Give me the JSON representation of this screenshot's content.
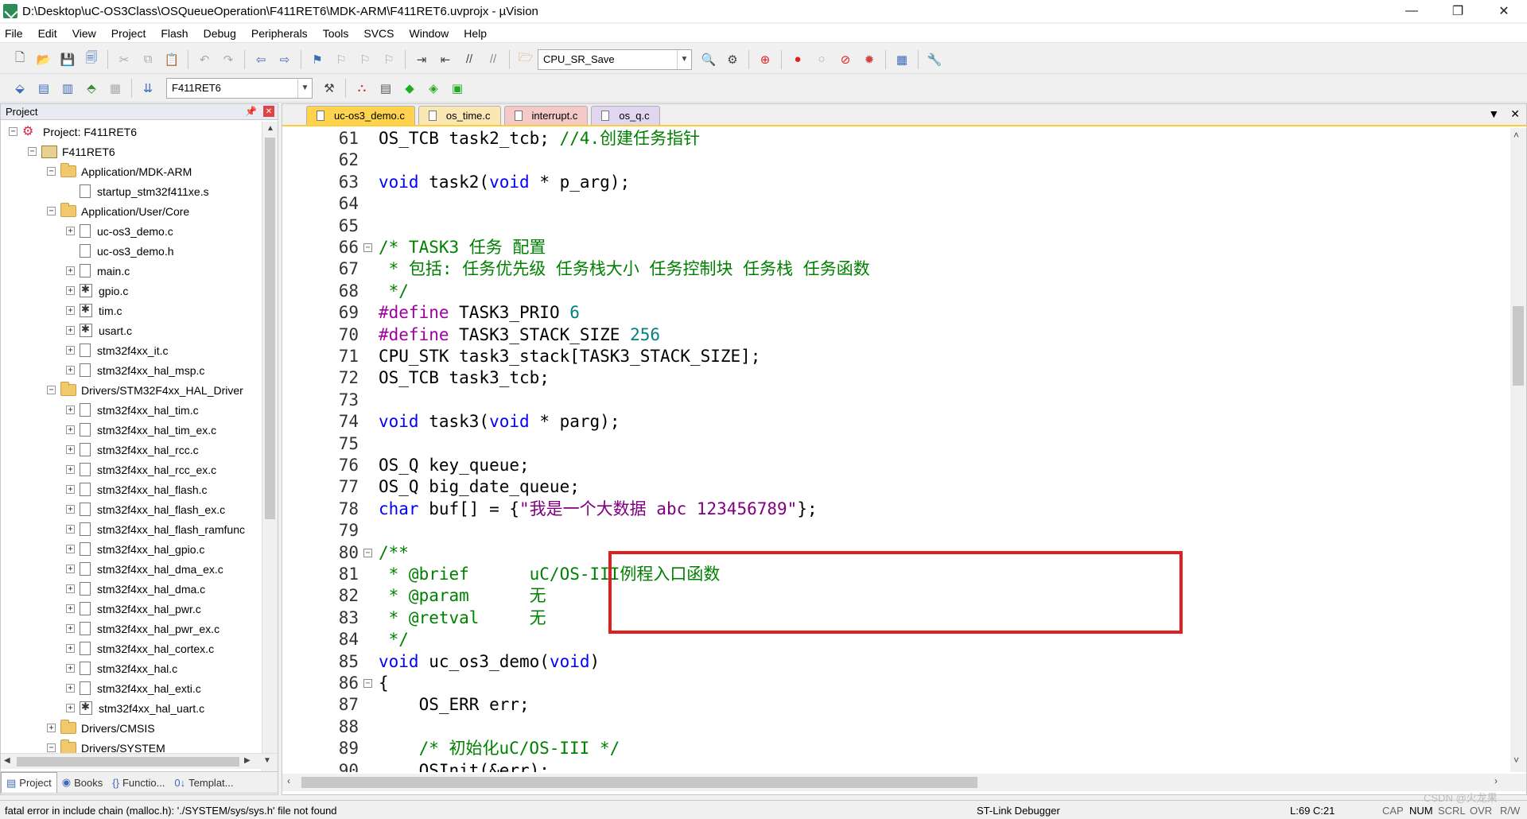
{
  "window": {
    "title": "D:\\Desktop\\uC-OS3Class\\OSQueueOperation\\F411RET6\\MDK-ARM\\F411RET6.uvprojx - µVision",
    "minimize": "—",
    "maximize": "❐",
    "close": "✕"
  },
  "menu": [
    "File",
    "Edit",
    "View",
    "Project",
    "Flash",
    "Debug",
    "Peripherals",
    "Tools",
    "SVCS",
    "Window",
    "Help"
  ],
  "toolbar": {
    "function_combo": "CPU_SR_Save",
    "target_combo": "F411RET6"
  },
  "project_panel": {
    "title": "Project",
    "tree": [
      {
        "level": 0,
        "type": "project",
        "label": "Project: F411RET6",
        "expander": "−"
      },
      {
        "level": 1,
        "type": "target",
        "label": "F411RET6",
        "expander": "−"
      },
      {
        "level": 2,
        "type": "folder",
        "label": "Application/MDK-ARM",
        "expander": "−"
      },
      {
        "level": 3,
        "type": "file",
        "label": "startup_stm32f411xe.s",
        "expander": ""
      },
      {
        "level": 2,
        "type": "folder",
        "label": "Application/User/Core",
        "expander": "−"
      },
      {
        "level": 3,
        "type": "file",
        "label": "uc-os3_demo.c",
        "expander": "+"
      },
      {
        "level": 3,
        "type": "file",
        "label": "uc-os3_demo.h",
        "expander": ""
      },
      {
        "level": 3,
        "type": "file",
        "label": "main.c",
        "expander": "+"
      },
      {
        "level": 3,
        "type": "filegear",
        "label": "gpio.c",
        "expander": "+"
      },
      {
        "level": 3,
        "type": "filegear",
        "label": "tim.c",
        "expander": "+"
      },
      {
        "level": 3,
        "type": "filegear",
        "label": "usart.c",
        "expander": "+"
      },
      {
        "level": 3,
        "type": "file",
        "label": "stm32f4xx_it.c",
        "expander": "+"
      },
      {
        "level": 3,
        "type": "file",
        "label": "stm32f4xx_hal_msp.c",
        "expander": "+"
      },
      {
        "level": 2,
        "type": "folder",
        "label": "Drivers/STM32F4xx_HAL_Driver",
        "expander": "−"
      },
      {
        "level": 3,
        "type": "file",
        "label": "stm32f4xx_hal_tim.c",
        "expander": "+"
      },
      {
        "level": 3,
        "type": "file",
        "label": "stm32f4xx_hal_tim_ex.c",
        "expander": "+"
      },
      {
        "level": 3,
        "type": "file",
        "label": "stm32f4xx_hal_rcc.c",
        "expander": "+"
      },
      {
        "level": 3,
        "type": "file",
        "label": "stm32f4xx_hal_rcc_ex.c",
        "expander": "+"
      },
      {
        "level": 3,
        "type": "file",
        "label": "stm32f4xx_hal_flash.c",
        "expander": "+"
      },
      {
        "level": 3,
        "type": "file",
        "label": "stm32f4xx_hal_flash_ex.c",
        "expander": "+"
      },
      {
        "level": 3,
        "type": "file",
        "label": "stm32f4xx_hal_flash_ramfunc",
        "expander": "+"
      },
      {
        "level": 3,
        "type": "file",
        "label": "stm32f4xx_hal_gpio.c",
        "expander": "+"
      },
      {
        "level": 3,
        "type": "file",
        "label": "stm32f4xx_hal_dma_ex.c",
        "expander": "+"
      },
      {
        "level": 3,
        "type": "file",
        "label": "stm32f4xx_hal_dma.c",
        "expander": "+"
      },
      {
        "level": 3,
        "type": "file",
        "label": "stm32f4xx_hal_pwr.c",
        "expander": "+"
      },
      {
        "level": 3,
        "type": "file",
        "label": "stm32f4xx_hal_pwr_ex.c",
        "expander": "+"
      },
      {
        "level": 3,
        "type": "file",
        "label": "stm32f4xx_hal_cortex.c",
        "expander": "+"
      },
      {
        "level": 3,
        "type": "file",
        "label": "stm32f4xx_hal.c",
        "expander": "+"
      },
      {
        "level": 3,
        "type": "file",
        "label": "stm32f4xx_hal_exti.c",
        "expander": "+"
      },
      {
        "level": 3,
        "type": "filegear",
        "label": "stm32f4xx_hal_uart.c",
        "expander": "+"
      },
      {
        "level": 2,
        "type": "folder",
        "label": "Drivers/CMSIS",
        "expander": "+"
      },
      {
        "level": 2,
        "type": "folder",
        "label": "Drivers/SYSTEM",
        "expander": "−"
      }
    ],
    "bottom_tabs": [
      {
        "icon": "▤",
        "label": "Project",
        "active": true
      },
      {
        "icon": "◉",
        "label": "Books",
        "active": false
      },
      {
        "icon": "{}",
        "label": "Functio...",
        "active": false
      },
      {
        "icon": "0↓",
        "label": "Templat...",
        "active": false
      }
    ]
  },
  "editor": {
    "tabs": [
      {
        "label": "uc-os3_demo.c",
        "style": "active"
      },
      {
        "label": "os_time.c",
        "style": "t2"
      },
      {
        "label": "interrupt.c",
        "style": "t3"
      },
      {
        "label": "os_q.c",
        "style": "t4"
      }
    ],
    "lines": [
      {
        "n": "61",
        "fold": "",
        "seg": [
          [
            "",
            "OS_TCB task2_tcb; "
          ],
          [
            "cm",
            "//4.创建任务指针"
          ]
        ]
      },
      {
        "n": "62",
        "fold": "",
        "seg": []
      },
      {
        "n": "63",
        "fold": "",
        "seg": [
          [
            "kw",
            "void"
          ],
          [
            "",
            " task2("
          ],
          [
            "kw",
            "void"
          ],
          [
            "",
            " * p_arg);"
          ]
        ]
      },
      {
        "n": "64",
        "fold": "",
        "seg": []
      },
      {
        "n": "65",
        "fold": "",
        "seg": []
      },
      {
        "n": "66",
        "fold": "−",
        "seg": [
          [
            "cm",
            "/* TASK3 任务 配置"
          ]
        ]
      },
      {
        "n": "67",
        "fold": "",
        "seg": [
          [
            "cm",
            " * 包括: 任务优先级 任务栈大小 任务控制块 任务栈 任务函数"
          ]
        ]
      },
      {
        "n": "68",
        "fold": "",
        "seg": [
          [
            "cm",
            " */"
          ]
        ]
      },
      {
        "n": "69",
        "fold": "",
        "seg": [
          [
            "pp",
            "#define"
          ],
          [
            "",
            " TASK3_PRIO "
          ],
          [
            "num",
            "6"
          ]
        ]
      },
      {
        "n": "70",
        "fold": "",
        "seg": [
          [
            "pp",
            "#define"
          ],
          [
            "",
            " TASK3_STACK_SIZE "
          ],
          [
            "num",
            "256"
          ]
        ]
      },
      {
        "n": "71",
        "fold": "",
        "seg": [
          [
            "",
            "CPU_STK task3_stack[TASK3_STACK_SIZE];"
          ]
        ]
      },
      {
        "n": "72",
        "fold": "",
        "seg": [
          [
            "",
            "OS_TCB task3_tcb;"
          ]
        ]
      },
      {
        "n": "73",
        "fold": "",
        "seg": []
      },
      {
        "n": "74",
        "fold": "",
        "seg": [
          [
            "kw",
            "void"
          ],
          [
            "",
            " task3("
          ],
          [
            "kw",
            "void"
          ],
          [
            "",
            " * parg);"
          ]
        ]
      },
      {
        "n": "75",
        "fold": "",
        "seg": []
      },
      {
        "n": "76",
        "fold": "",
        "seg": [
          [
            "",
            "OS_Q key_queue;"
          ]
        ]
      },
      {
        "n": "77",
        "fold": "",
        "seg": [
          [
            "",
            "OS_Q big_date_queue;"
          ]
        ]
      },
      {
        "n": "78",
        "fold": "",
        "seg": [
          [
            "kw",
            "char"
          ],
          [
            "",
            " buf[] = {"
          ],
          [
            "str",
            "\"我是一个大数据 abc 123456789\""
          ],
          [
            "",
            "};"
          ]
        ]
      },
      {
        "n": "79",
        "fold": "",
        "seg": []
      },
      {
        "n": "80",
        "fold": "−",
        "seg": [
          [
            "cm",
            "/**"
          ]
        ]
      },
      {
        "n": "81",
        "fold": "",
        "seg": [
          [
            "cm",
            " * @brief      uC/OS-III例程入口函数"
          ]
        ]
      },
      {
        "n": "82",
        "fold": "",
        "seg": [
          [
            "cm",
            " * @param      无"
          ]
        ]
      },
      {
        "n": "83",
        "fold": "",
        "seg": [
          [
            "cm",
            " * @retval     无"
          ]
        ]
      },
      {
        "n": "84",
        "fold": "",
        "seg": [
          [
            "cm",
            " */"
          ]
        ]
      },
      {
        "n": "85",
        "fold": "",
        "seg": [
          [
            "kw",
            "void"
          ],
          [
            "",
            " uc_os3_demo("
          ],
          [
            "kw",
            "void"
          ],
          [
            "",
            ")"
          ]
        ]
      },
      {
        "n": "86",
        "fold": "−",
        "seg": [
          [
            "",
            "{"
          ]
        ]
      },
      {
        "n": "87",
        "fold": "",
        "seg": [
          [
            "",
            "    OS_ERR err;"
          ]
        ]
      },
      {
        "n": "88",
        "fold": "",
        "seg": []
      },
      {
        "n": "89",
        "fold": "",
        "seg": [
          [
            "",
            "    "
          ],
          [
            "cm",
            "/* 初始化uC/OS-III */"
          ]
        ]
      },
      {
        "n": "90",
        "fold": "",
        "seg": [
          [
            "",
            "    OSInit(&err);"
          ]
        ]
      }
    ]
  },
  "status": {
    "message": "fatal error in include chain (malloc.h): './SYSTEM/sys/sys.h' file not found",
    "debugger": "ST-Link Debugger",
    "cursor": "L:69 C:21",
    "caps": "CAP",
    "num": "NUM",
    "scrl": "SCRL",
    "ovr": "OVR",
    "rw": "R/W",
    "watermark": "CSDN @火龙果"
  }
}
